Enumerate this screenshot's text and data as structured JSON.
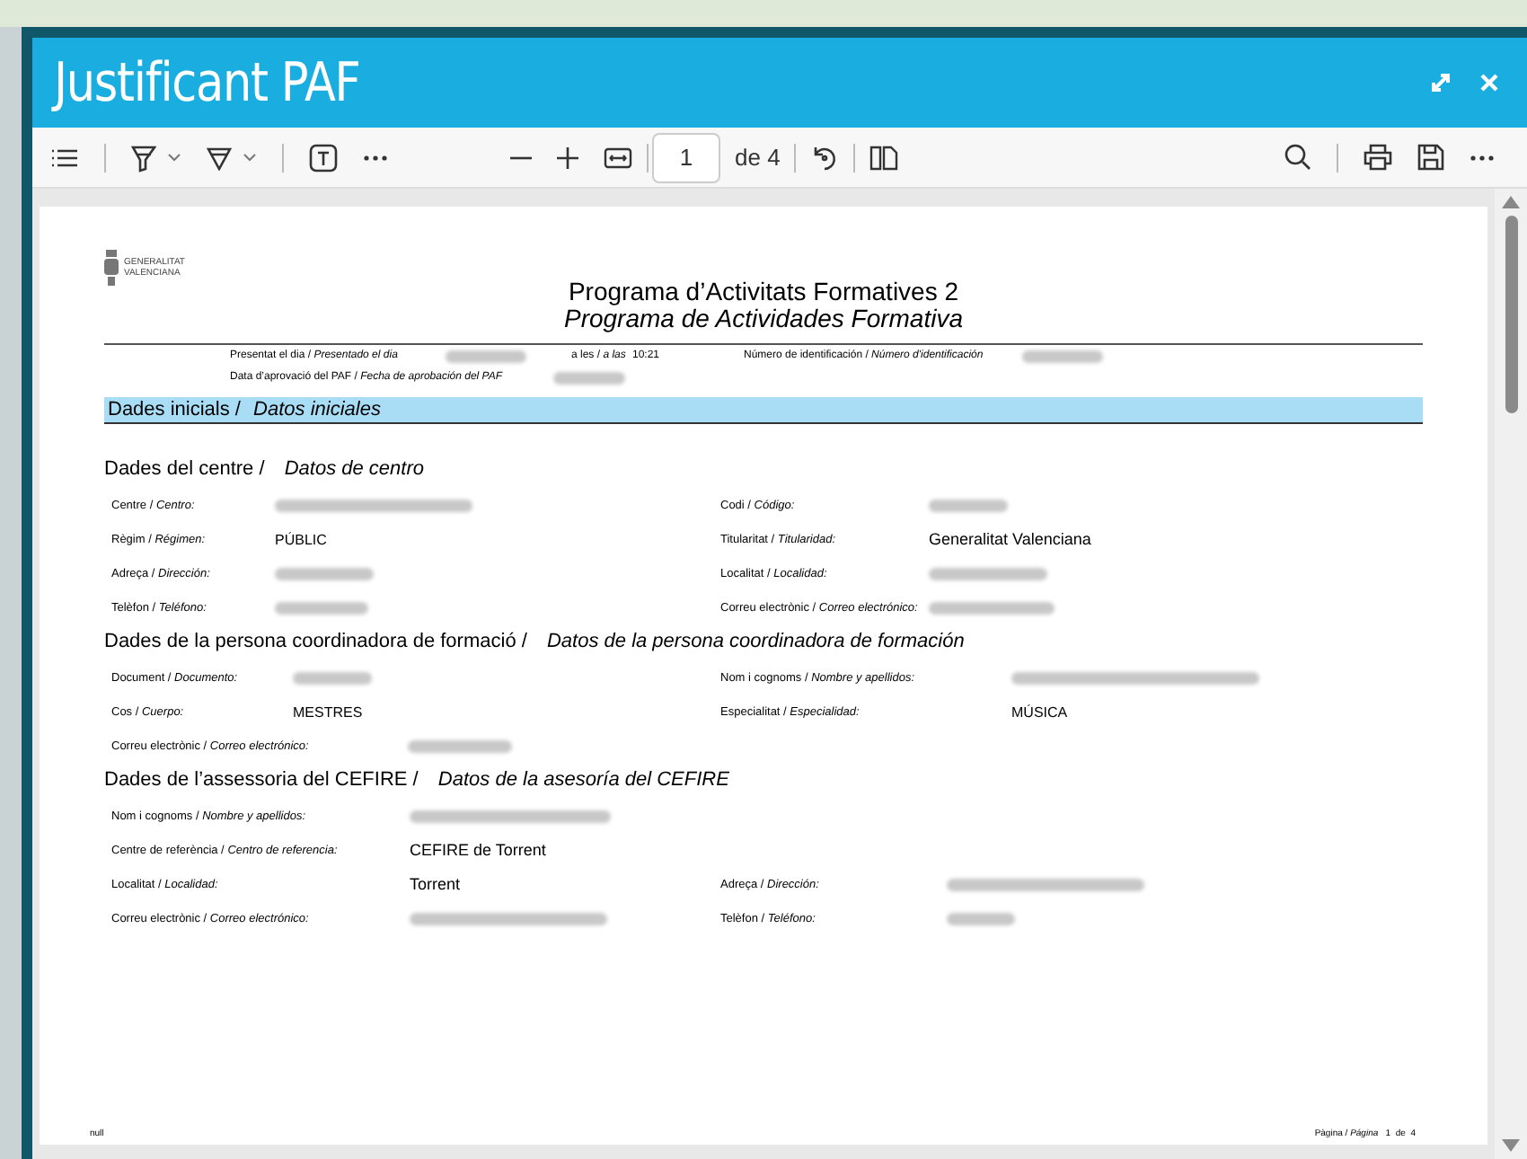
{
  "window": {
    "title": "Justificant PAF"
  },
  "toolbar": {
    "page": "1",
    "page_count": "de 4"
  },
  "document": {
    "logo_text": "GENERALITAT VALENCIANA",
    "title": "Programa d’Activitats Formatives 2",
    "subtitle": "Programa de Actividades Formativa",
    "meta": [
      {
        "label": "Presentat el dia / *Presentado el dia*",
        "redacted": true
      },
      {
        "label": "a les / *a las*",
        "value": "10:21"
      },
      {
        "label": "Número de identificación / *Número d'identificación*",
        "redacted": true
      },
      {
        "label": "Data d’aprovació del PAF / *Fecha de aprobación del PAF*",
        "redacted": true
      }
    ],
    "band": {
      "label": "Dades inicials / ",
      "label_es": "Datos iniciales"
    },
    "sections": [
      {
        "heading": "Dades del centre / ",
        "heading_es": "Datos de centro",
        "fields": [
          {
            "label": "Centre / *Centro:*",
            "redacted": true
          },
          {
            "label": "Codi / *Código:*",
            "redacted": true
          },
          {
            "label": "Règim / *Régimen:*",
            "value": "PÚBLIC"
          },
          {
            "label": "Titularitat / *Titularidad:*",
            "value": "Generalitat Valenciana"
          },
          {
            "label": "Adreça / *Dirección:*",
            "redacted": true
          },
          {
            "label": "Localitat / *Localidad:*",
            "redacted": true
          },
          {
            "label": "Telèfon / *Teléfono:*",
            "redacted": true
          },
          {
            "label": "Correu electrònic / *Correo electrónico:*",
            "redacted": true
          }
        ]
      },
      {
        "heading": "Dades de la persona coordinadora de formació / ",
        "heading_es": "Datos de la persona coordinadora de formación",
        "fields": [
          {
            "label": "Document / *Documento:*",
            "redacted": true
          },
          {
            "label": "Nom i cognoms / *Nombre y apellidos:*",
            "redacted": true
          },
          {
            "label": "Cos / *Cuerpo:*",
            "value": "MESTRES"
          },
          {
            "label": "Especialitat / *Especialidad:*",
            "value": "MÚSICA"
          },
          {
            "label": "Correu electrònic / *Correo electrónico:*",
            "redacted": true
          }
        ]
      },
      {
        "heading": "Dades de l’assessoria del CEFIRE / ",
        "heading_es": "Datos de la asesoría del CEFIRE",
        "fields": [
          {
            "label": "Nom i cognoms / *Nombre y apellidos:*",
            "redacted": true,
            "full": true
          },
          {
            "label": "Centre de referència / *Centro de referencia:*",
            "value": "CEFIRE de Torrent",
            "full": true
          },
          {
            "label": "Localitat / *Localidad:*",
            "value": "Torrent"
          },
          {
            "label": "Adreça / *Dirección:*",
            "redacted": true
          },
          {
            "label": "Correu electrònic / *Correo electrónico:*",
            "redacted": true
          },
          {
            "label": "Telèfon / *Teléfono:*",
            "redacted": true
          }
        ]
      }
    ],
    "footer": {
      "left": "null",
      "right": "Pàgina / *Página*   1  de  4"
    }
  }
}
